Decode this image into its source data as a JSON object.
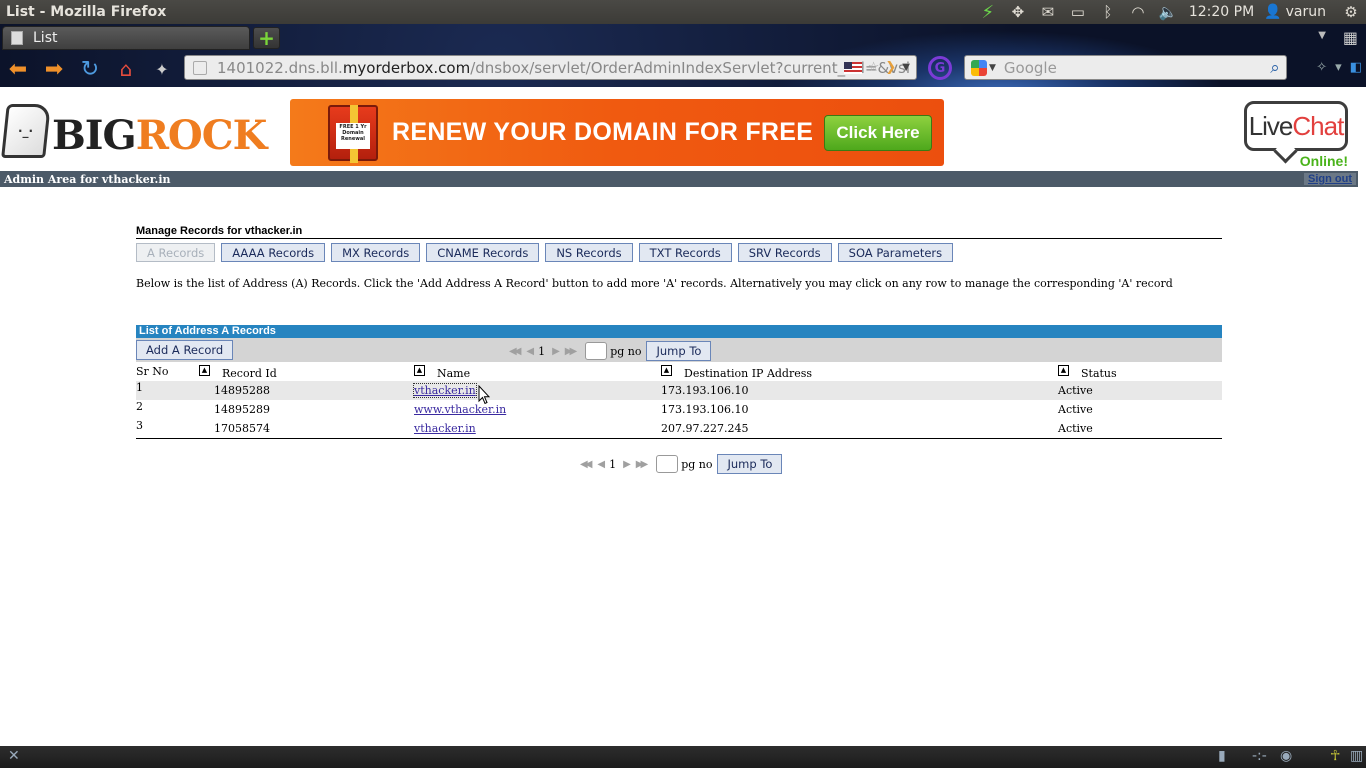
{
  "os": {
    "window_title": "List - Mozilla Firefox",
    "clock": "12:20 PM",
    "user": "varun",
    "tray_icons": [
      "power-bolt-icon",
      "dropbox-icon",
      "mail-icon",
      "battery-icon",
      "bluetooth-icon",
      "wifi-icon",
      "volume-icon"
    ]
  },
  "browser": {
    "tab_title": "List",
    "url_prefix": "1401022.dns.bll.",
    "url_host": "myorderbox.com",
    "url_path": "/dnsbox/servlet/OrderAdminIndexServlet?current_url=&vsi",
    "search_placeholder": "Google"
  },
  "header": {
    "logo_big": "BIG",
    "logo_rock": "ROCK",
    "banner_text": "RENEW YOUR DOMAIN FOR FREE",
    "banner_button": "Click Here",
    "gift_tag": "FREE 1 Yr Domain Renewal",
    "livechat_live": "Live",
    "livechat_chat": "Chat",
    "livechat_status": "Online!"
  },
  "admin_bar": {
    "text": "Admin Area for vthacker.in",
    "signout": "Sign out"
  },
  "manage": {
    "title": "Manage Records for vthacker.in",
    "tabs": [
      {
        "label": "A Records",
        "active": true
      },
      {
        "label": "AAAA Records"
      },
      {
        "label": "MX Records"
      },
      {
        "label": "CNAME Records"
      },
      {
        "label": "NS Records"
      },
      {
        "label": "TXT Records"
      },
      {
        "label": "SRV Records"
      },
      {
        "label": "SOA Parameters"
      }
    ],
    "description": "Below is the list of Address (A) Records. Click the 'Add Address A Record' button to add more 'A' records. Alternatively you may click on any row to manage the corresponding 'A' record"
  },
  "list": {
    "header": "List of Address A Records",
    "add_button": "Add A Record",
    "pager": {
      "page": "1",
      "label": "pg no",
      "jump": "Jump To"
    },
    "columns": [
      "Sr No",
      "Record Id",
      "Name",
      "Destination IP Address",
      "Status"
    ],
    "rows": [
      {
        "sr": "1",
        "record_id": "14895288",
        "name": "vthacker.in",
        "ip": "173.193.106.10",
        "status": "Active"
      },
      {
        "sr": "2",
        "record_id": "14895289",
        "name": "www.vthacker.in",
        "ip": "173.193.106.10",
        "status": "Active"
      },
      {
        "sr": "3",
        "record_id": "17058574",
        "name": "vthacker.in",
        "ip": "207.97.227.245",
        "status": "Active"
      }
    ]
  }
}
